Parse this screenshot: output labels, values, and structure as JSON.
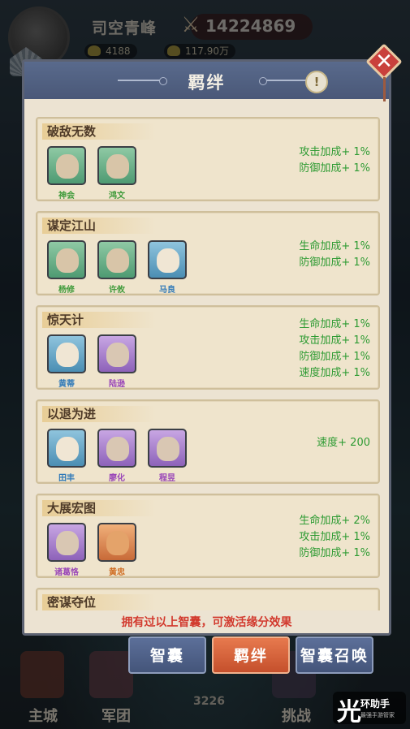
{
  "hud": {
    "player_name": "司空青峰",
    "power": "14224869",
    "gold": "4188",
    "silver": "117.90万"
  },
  "modal": {
    "title": "羁绊",
    "info_icon": "!",
    "close_icon": "✕"
  },
  "bonds": [
    {
      "title": "破敌无数",
      "heroes": [
        {
          "name": "神会",
          "rarity": "green"
        },
        {
          "name": "鸿文",
          "rarity": "green"
        }
      ],
      "bonuses": [
        "攻击加成+ 1%",
        "防御加成+ 1%"
      ]
    },
    {
      "title": "谋定江山",
      "heroes": [
        {
          "name": "杨修",
          "rarity": "green"
        },
        {
          "name": "许攸",
          "rarity": "green"
        },
        {
          "name": "马良",
          "rarity": "blue"
        }
      ],
      "bonuses": [
        "生命加成+ 1%",
        "防御加成+ 1%"
      ]
    },
    {
      "title": "惊天计",
      "heroes": [
        {
          "name": "黄蒂",
          "rarity": "blue"
        },
        {
          "name": "陆逊",
          "rarity": "purple"
        }
      ],
      "bonuses": [
        "生命加成+ 1%",
        "攻击加成+ 1%",
        "防御加成+ 1%",
        "速度加成+ 1%"
      ]
    },
    {
      "title": "以退为进",
      "heroes": [
        {
          "name": "田丰",
          "rarity": "blue"
        },
        {
          "name": "廖化",
          "rarity": "purple"
        },
        {
          "name": "程昱",
          "rarity": "purple"
        }
      ],
      "bonuses": [
        "速度+ 200"
      ]
    },
    {
      "title": "大展宏图",
      "heroes": [
        {
          "name": "诸葛恪",
          "rarity": "purple"
        },
        {
          "name": "黄忠",
          "rarity": "orange"
        }
      ],
      "bonuses": [
        "生命加成+ 2%",
        "攻击加成+ 1%",
        "防御加成+ 1%"
      ]
    },
    {
      "title": "密谋夺位",
      "heroes": [],
      "bonuses": []
    }
  ],
  "footer_note": "拥有过以上智囊，可激活缘分效果",
  "tabs": [
    "智囊",
    "羁绊",
    "智囊召唤"
  ],
  "active_tab": "羁绊",
  "bottom_nav": {
    "home": "主城",
    "legion": "军团",
    "battle_power": "3226",
    "challenge": "挑战"
  },
  "watermark": {
    "mark": "光",
    "title": "环助手",
    "subtitle": "最强手游管家"
  },
  "colors": {
    "bonus_text": "#2e9b33",
    "footer_text": "#d23a2e",
    "header": "#4a5878",
    "active_tab": "#d8603a"
  },
  "icons": [
    "fan-icon",
    "sword-power-icon",
    "gold-ingot-icon",
    "close-icon",
    "info-icon"
  ]
}
